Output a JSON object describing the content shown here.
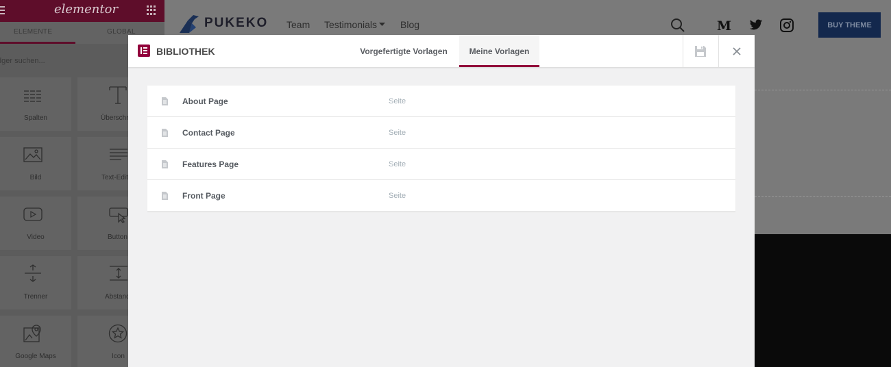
{
  "panel": {
    "logo": "elementor",
    "tabs": [
      "ELEMENTE",
      "GLOBAL"
    ],
    "search_placeholder": "dger suchen...",
    "widgets": [
      {
        "label": "Spalten",
        "icon": "columns-icon"
      },
      {
        "label": "Überschrift",
        "icon": "heading-icon"
      },
      {
        "label": "Bild",
        "icon": "image-icon"
      },
      {
        "label": "Text-Editor",
        "icon": "text-editor-icon"
      },
      {
        "label": "Video",
        "icon": "video-icon"
      },
      {
        "label": "Button",
        "icon": "button-icon"
      },
      {
        "label": "Trenner",
        "icon": "divider-icon"
      },
      {
        "label": "Abstand",
        "icon": "spacer-icon"
      },
      {
        "label": "Google Maps",
        "icon": "map-icon"
      },
      {
        "label": "Icon",
        "icon": "star-icon"
      }
    ]
  },
  "site": {
    "logo": "PUKEKO",
    "nav": [
      "Team",
      "Testimonials",
      "Blog"
    ],
    "buy_button": "BUY THEME",
    "colors": {
      "buy_button": "#13284d"
    }
  },
  "library": {
    "title": "BIBLIOTHEK",
    "tabs": [
      "Vorgefertigte Vorlagen",
      "Meine Vorlagen"
    ],
    "active_tab": "Meine Vorlagen",
    "templates": [
      {
        "name": "About Page",
        "type": "Seite"
      },
      {
        "name": "Contact Page",
        "type": "Seite"
      },
      {
        "name": "Features Page",
        "type": "Seite"
      },
      {
        "name": "Front Page",
        "type": "Seite"
      }
    ],
    "colors": {
      "accent": "#92003b"
    }
  }
}
